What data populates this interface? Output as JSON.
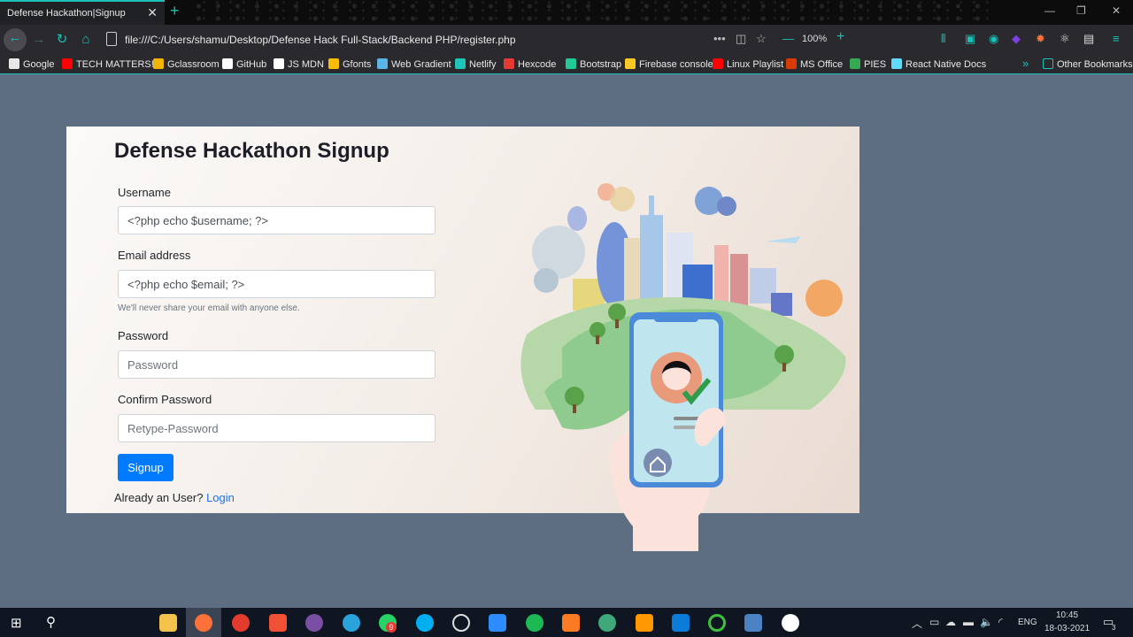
{
  "browser": {
    "tab_title": "Defense Hackathon|Signup",
    "url": "file:///C:/Users/shamu/Desktop/Defense Hack Full-Stack/Backend PHP/register.php",
    "zoom": "100%",
    "other_bookmarks": "Other Bookmarks"
  },
  "bookmarks": [
    {
      "label": "Google",
      "color": "#e8e8e8"
    },
    {
      "label": "TECH MATTERS!",
      "color": "#ff0000"
    },
    {
      "label": "Gclassroom",
      "color": "#f4b400"
    },
    {
      "label": "GitHub",
      "color": "#ffffff"
    },
    {
      "label": "JS MDN",
      "color": "#ffffff"
    },
    {
      "label": "Gfonts",
      "color": "#fbbc04"
    },
    {
      "label": "Web Gradient",
      "color": "#5ab4e8"
    },
    {
      "label": "Netlify",
      "color": "#20c6b7"
    },
    {
      "label": "Hexcode",
      "color": "#e53935"
    },
    {
      "label": "Bootstrap",
      "color": "#20c997"
    },
    {
      "label": "Firebase console",
      "color": "#ffca28"
    },
    {
      "label": "Linux Playlist",
      "color": "#ff0000"
    },
    {
      "label": "MS Office",
      "color": "#d83b01"
    },
    {
      "label": "PIES",
      "color": "#34a853"
    },
    {
      "label": "React Native Docs",
      "color": "#61dafb"
    }
  ],
  "form": {
    "title": "Defense Hackathon Signup",
    "username_label": "Username",
    "username_value": "<?php echo $username; ?>",
    "email_label": "Email address",
    "email_value": "<?php echo $email; ?>",
    "email_help": "We'll never share your email with anyone else.",
    "password_label": "Password",
    "password_placeholder": "Password",
    "confirm_label": "Confirm Password",
    "confirm_placeholder": "Retype-Password",
    "submit_label": "Signup",
    "already_text": "Already an User?",
    "login_link": "Login"
  },
  "taskbar": {
    "language": "ENG",
    "time": "10:45",
    "date": "18-03-2021",
    "notification_count": "3",
    "whatsapp_badge": "9"
  }
}
